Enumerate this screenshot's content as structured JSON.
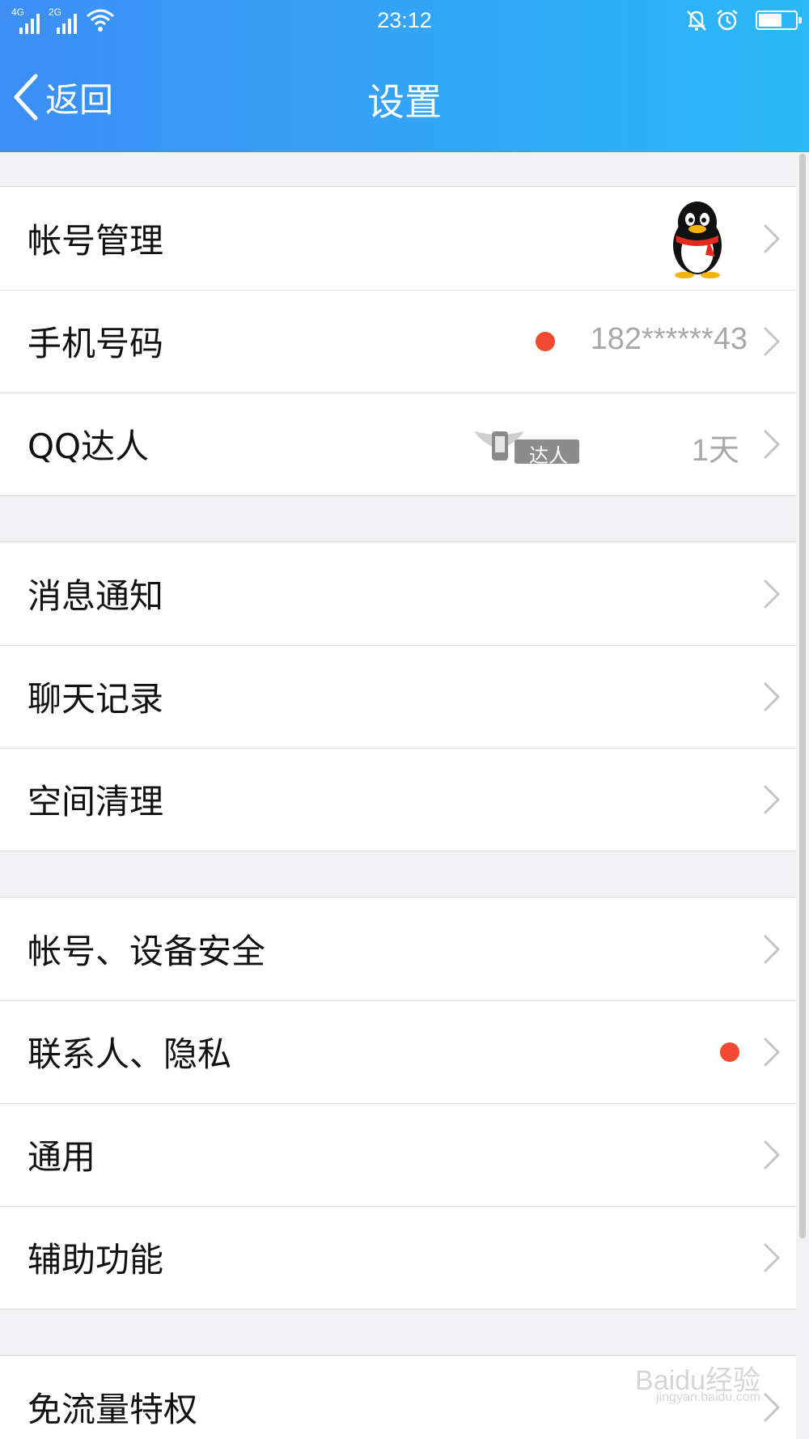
{
  "status_bar": {
    "net1": "4G",
    "net2": "2G",
    "time": "23:12"
  },
  "nav": {
    "back_label": "返回",
    "title": "设置"
  },
  "groups": [
    {
      "rows": [
        {
          "label": "帐号管理",
          "accessory": "avatar"
        },
        {
          "label": "手机号码",
          "value": "182******43",
          "red_dot": true
        },
        {
          "label": "QQ达人",
          "badge_text": "达人",
          "value": "1天"
        }
      ]
    },
    {
      "rows": [
        {
          "label": "消息通知"
        },
        {
          "label": "聊天记录"
        },
        {
          "label": "空间清理"
        }
      ]
    },
    {
      "rows": [
        {
          "label": "帐号、设备安全"
        },
        {
          "label": "联系人、隐私",
          "red_dot": true
        },
        {
          "label": "通用"
        },
        {
          "label": "辅助功能"
        }
      ]
    },
    {
      "rows": [
        {
          "label": "免流量特权"
        }
      ]
    }
  ],
  "watermark": {
    "brand": "Baidu经验",
    "url": "jingyan.baidu.com"
  },
  "colors": {
    "header_start": "#3d8ef5",
    "header_end": "#2bb9f8",
    "red_dot": "#f0492f",
    "background": "#f2f2f4"
  },
  "icons": [
    "signal-icon",
    "wifi-icon",
    "mute-bell-icon",
    "alarm-icon",
    "battery-icon",
    "back-chevron-icon",
    "chevron-right-icon",
    "qq-penguin-avatar",
    "daren-badge-icon"
  ]
}
